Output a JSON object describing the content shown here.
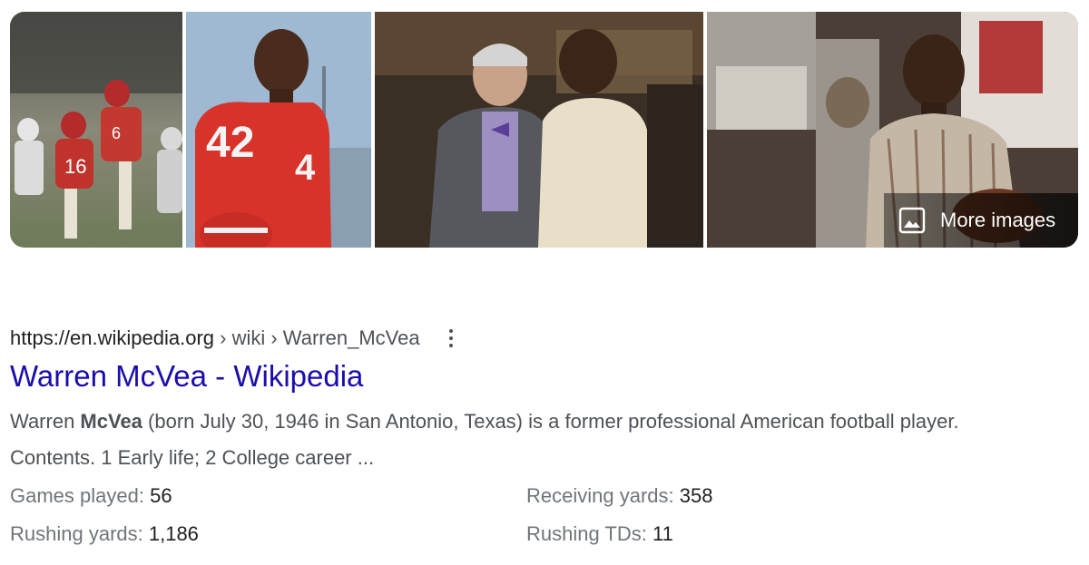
{
  "images": {
    "items": [
      {
        "icon": "football-action-photo"
      },
      {
        "icon": "football-player-portrait-photo"
      },
      {
        "icon": "two-men-event-photo"
      },
      {
        "icon": "man-holding-football-photo"
      }
    ],
    "more_label": "More images",
    "more_icon": "image-icon"
  },
  "result": {
    "url_base": "https://en.wikipedia.org",
    "url_path": " › wiki › Warren_McVea",
    "menu_icon": "more-vert-icon",
    "title": "Warren McVea - Wikipedia",
    "snippet_pre": "Warren ",
    "snippet_bold": "McVea",
    "snippet_post": " (born July 30, 1946 in San Antonio, Texas) is a former professional American football player. Contents. 1 Early life; 2 College career ...",
    "facts": [
      {
        "label": "Games played: ",
        "value": "56"
      },
      {
        "label": "Receiving yards: ",
        "value": "358"
      },
      {
        "label": "Rushing yards: ",
        "value": "1,186"
      },
      {
        "label": "Rushing TDs: ",
        "value": "11"
      }
    ]
  },
  "colors": {
    "link": "#1a0dab",
    "text": "#202124",
    "secondary": "#4d5156",
    "muted": "#70757a"
  }
}
